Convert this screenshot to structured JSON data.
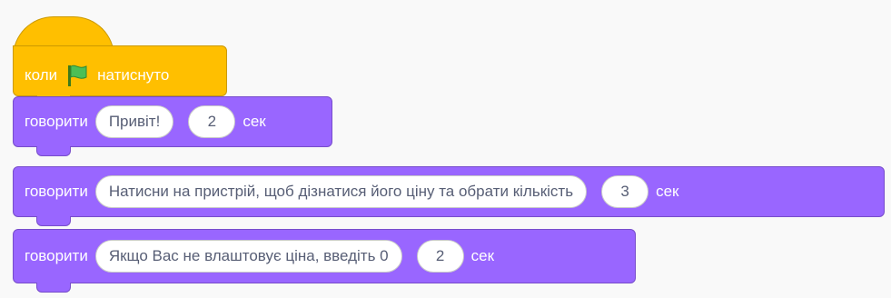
{
  "hat_block": {
    "label_before": "коли",
    "label_after": "натиснуто",
    "icon": "green-flag-icon"
  },
  "say_blocks": [
    {
      "verb": "говорити",
      "message": "Привіт!",
      "seconds": "2",
      "unit": "сек"
    },
    {
      "verb": "говорити",
      "message": "Натисни на пристрій, щоб дізнатися його ціну та обрати кількість",
      "seconds": "3",
      "unit": "сек"
    },
    {
      "verb": "говорити",
      "message": "Якщо Вас не влаштовує ціна, введіть 0",
      "seconds": "2",
      "unit": "сек"
    }
  ],
  "colors": {
    "events": "#ffbf00",
    "looks": "#9966ff",
    "background": "#f9f9f9"
  }
}
